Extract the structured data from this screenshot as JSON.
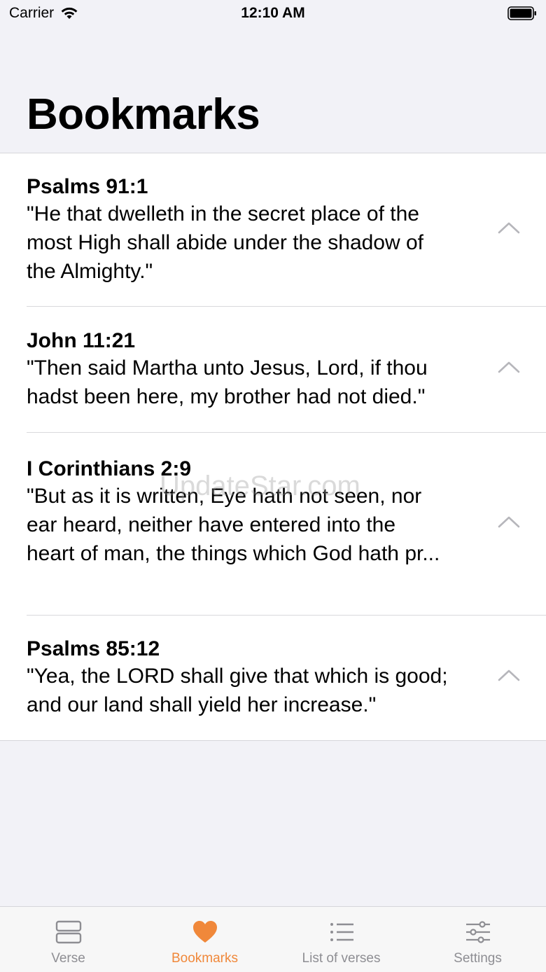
{
  "status_bar": {
    "carrier": "Carrier",
    "time": "12:10 AM"
  },
  "header": {
    "title": "Bookmarks"
  },
  "bookmarks": [
    {
      "reference": "Psalms 91:1",
      "text": "\"He that dwelleth in the secret place of the\nmost High shall abide under the shadow of\nthe Almighty.\""
    },
    {
      "reference": "John 11:21",
      "text": "\"Then said Martha unto Jesus, Lord, if thou\nhadst been here, my brother had not died.\""
    },
    {
      "reference": "I Corinthians 2:9",
      "text": "\"But as it is written, Eye hath not seen, nor\near heard, neither have entered into the\nheart of man, the things which God hath pr..."
    },
    {
      "reference": "Psalms 85:12",
      "text": "\"Yea, the LORD shall give that which is good;\nand our land shall yield her increase.\""
    }
  ],
  "watermark": "UpdateStar.com",
  "tabs": [
    {
      "label": "Verse",
      "icon": "verse-icon"
    },
    {
      "label": "Bookmarks",
      "icon": "heart-icon"
    },
    {
      "label": "List of verses",
      "icon": "list-icon"
    },
    {
      "label": "Settings",
      "icon": "sliders-icon"
    }
  ],
  "colors": {
    "accent": "#f0883a",
    "inactive": "#8e8e93",
    "background": "#f2f2f7"
  }
}
